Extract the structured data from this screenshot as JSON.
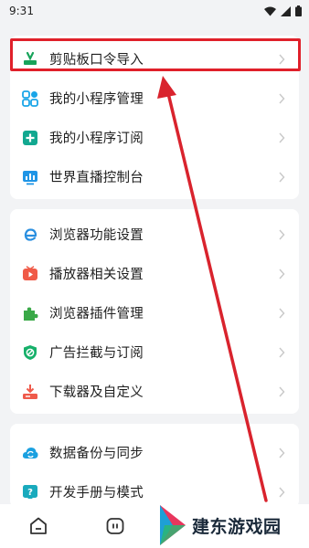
{
  "status_bar": {
    "time": "9:31"
  },
  "group1": [
    {
      "label": "剪贴板口令导入",
      "icon": "clipboard-import-icon",
      "color": "#17a35a"
    },
    {
      "label": "我的小程序管理",
      "icon": "mini-program-grid-icon",
      "color": "#1aa5e8"
    },
    {
      "label": "我的小程序订阅",
      "icon": "mini-program-subscribe-icon",
      "color": "#12a890"
    },
    {
      "label": "世界直播控制台",
      "icon": "live-console-icon",
      "color": "#1f95e6"
    }
  ],
  "group2": [
    {
      "label": "浏览器功能设置",
      "icon": "browser-e-icon",
      "color": "#2a8fe0"
    },
    {
      "label": "播放器相关设置",
      "icon": "player-icon",
      "color": "#f05a47"
    },
    {
      "label": "浏览器插件管理",
      "icon": "puzzle-icon",
      "color": "#3aa948"
    },
    {
      "label": "广告拦截与订阅",
      "icon": "shield-block-icon",
      "color": "#16b06a"
    },
    {
      "label": "下载器及自定义",
      "icon": "download-icon",
      "color": "#ef5a4b"
    }
  ],
  "group3": [
    {
      "label": "数据备份与同步",
      "icon": "sync-cloud-icon",
      "color": "#1aa0e0"
    },
    {
      "label": "开发手册与模式",
      "icon": "help-manual-icon",
      "color": "#19aabd"
    }
  ],
  "watermark": {
    "text": "建东游戏园"
  },
  "colors": {
    "highlight": "#e0202a",
    "background": "#f2f3f5"
  }
}
